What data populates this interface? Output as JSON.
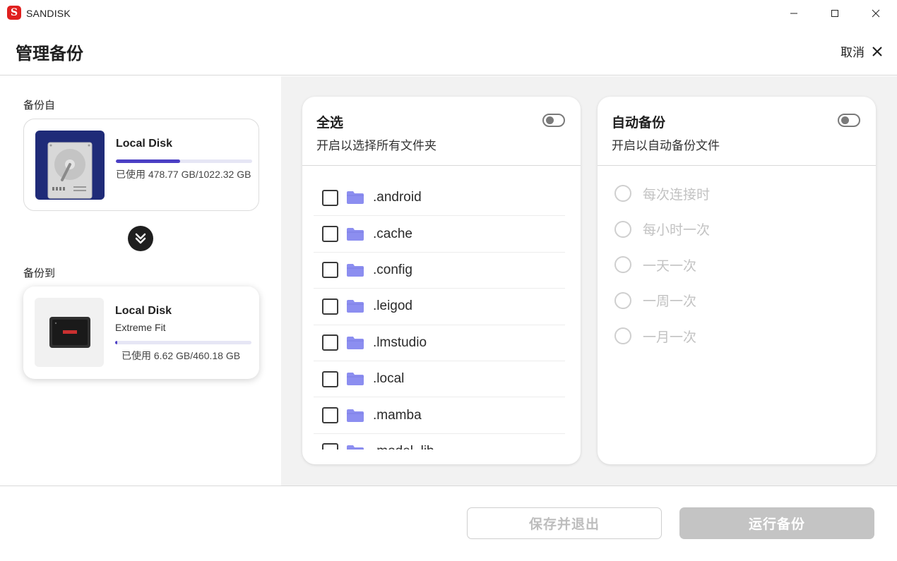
{
  "window": {
    "app_name": "SANDISK",
    "logo_letter": "S"
  },
  "header": {
    "title": "管理备份",
    "cancel_label": "取消"
  },
  "source": {
    "label": "备份自",
    "disk_name": "Local Disk",
    "usage": "已使用 478.77 GB/1022.32 GB",
    "used_fraction": 0.47
  },
  "destination": {
    "label": "备份到",
    "disk_name": "Local Disk",
    "model": "Extreme Fit",
    "usage": "已使用 6.62 GB/460.18 GB",
    "used_fraction": 0.014
  },
  "select_all": {
    "title": "全选",
    "subtitle": "开启以选择所有文件夹",
    "enabled": false,
    "folders": [
      ".android",
      ".cache",
      ".config",
      ".leigod",
      ".lmstudio",
      ".local",
      ".mamba",
      ".model_lib"
    ]
  },
  "auto_backup": {
    "title": "自动备份",
    "subtitle": "开启以自动备份文件",
    "enabled": false,
    "options": [
      "每次连接时",
      "每小时一次",
      "一天一次",
      "一周一次",
      "一月一次"
    ]
  },
  "footer": {
    "save_label": "保存并退出",
    "run_label": "运行备份"
  },
  "colors": {
    "accent": "#4b3fc4",
    "folder": "#8c8ef0",
    "brand": "#e0201f"
  }
}
